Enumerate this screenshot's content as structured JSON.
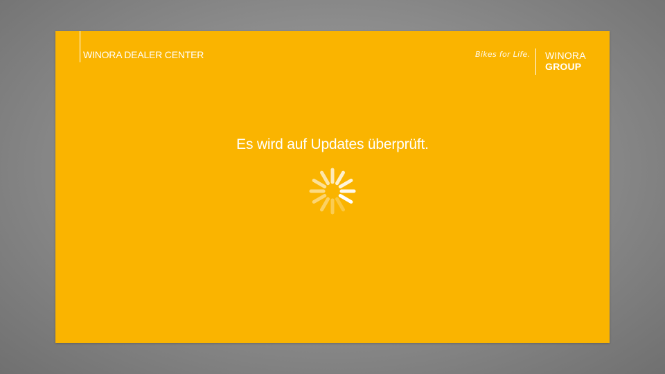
{
  "app": {
    "title": "WINORA DEALER CENTER"
  },
  "brand": {
    "tagline": "Bikes for Life.",
    "logo_line1": "WINORA",
    "logo_line2": "GROUP"
  },
  "status": {
    "message": "Es wird auf Updates überprüft."
  },
  "theme": {
    "accent": "#fab400",
    "foreground": "#ffffff",
    "backdrop": "#8f8f8f"
  },
  "icons": {
    "spinner": "loading-spinner-icon"
  }
}
